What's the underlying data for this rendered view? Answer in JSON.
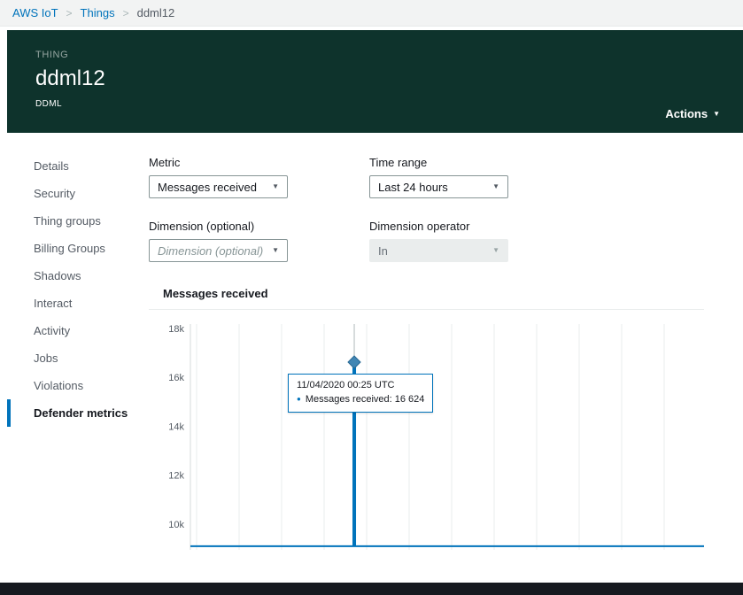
{
  "breadcrumb": {
    "separator": ">",
    "items": [
      {
        "label": "AWS IoT",
        "link": true
      },
      {
        "label": "Things",
        "link": true
      },
      {
        "label": "ddml12",
        "link": false
      }
    ]
  },
  "header": {
    "eyebrow": "THING",
    "title": "ddml12",
    "subtitle": "DDML",
    "actions_label": "Actions"
  },
  "sidebar": {
    "items": [
      {
        "label": "Details"
      },
      {
        "label": "Security"
      },
      {
        "label": "Thing groups"
      },
      {
        "label": "Billing Groups"
      },
      {
        "label": "Shadows"
      },
      {
        "label": "Interact"
      },
      {
        "label": "Activity"
      },
      {
        "label": "Jobs"
      },
      {
        "label": "Violations"
      },
      {
        "label": "Defender metrics",
        "active": true
      }
    ]
  },
  "filters": {
    "metric": {
      "label": "Metric",
      "value": "Messages received"
    },
    "time_range": {
      "label": "Time range",
      "value": "Last 24 hours"
    },
    "dimension": {
      "label": "Dimension (optional)",
      "placeholder": "Dimension (optional)"
    },
    "dimension_operator": {
      "label": "Dimension operator",
      "value": "In",
      "disabled": true
    }
  },
  "chart_data": {
    "type": "line",
    "title": "Messages received",
    "xlabel": "",
    "ylabel": "",
    "ylim": [
      8950,
      18180
    ],
    "y_ticks": [
      {
        "label": "18k",
        "value": 18000
      },
      {
        "label": "16k",
        "value": 16000
      },
      {
        "label": "14k",
        "value": 14000
      },
      {
        "label": "12k",
        "value": 12000
      },
      {
        "label": "10k",
        "value": 10000
      }
    ],
    "x_gridline_count": 12,
    "grid": "vertical",
    "legend": "none",
    "series": [
      {
        "name": "Messages received",
        "color": "#0073bb",
        "baseline_value": 9100,
        "peak": {
          "time": "11/04/2020 00:25 UTC",
          "value": 16624,
          "x_fraction": 0.319
        }
      }
    ],
    "tooltip": {
      "time": "11/04/2020 00:25 UTC",
      "text": "Messages received: 16 624"
    }
  },
  "colors": {
    "accent": "#0073bb",
    "header_bg": "#0e332c",
    "footer_bg": "#16191f",
    "line": "#0073bb"
  }
}
